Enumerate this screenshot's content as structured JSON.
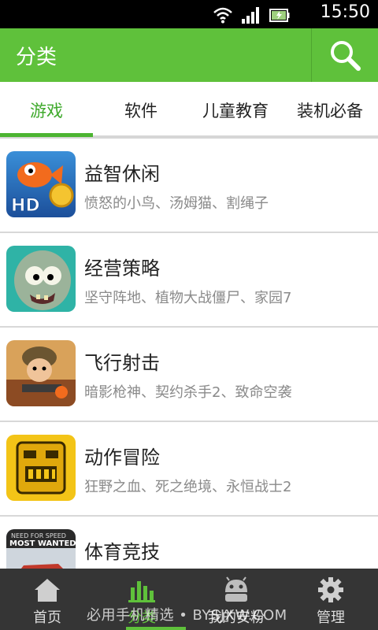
{
  "status_bar": {
    "time": "15:50",
    "icons": [
      "wifi-icon",
      "signal-icon",
      "battery-icon"
    ]
  },
  "app_bar": {
    "title": "分类",
    "search_icon": "search-icon"
  },
  "tabs": [
    {
      "label": "游戏",
      "active": true
    },
    {
      "label": "软件",
      "active": false
    },
    {
      "label": "儿童教育",
      "active": false
    },
    {
      "label": "装机必备",
      "active": false
    }
  ],
  "categories": [
    {
      "name": "益智休闲",
      "desc": "愤怒的小鸟、汤姆猫、割绳子",
      "icon": "fish-hd-icon"
    },
    {
      "name": "经营策略",
      "desc": "坚守阵地、植物大战僵尸、家园7",
      "icon": "zombie-icon"
    },
    {
      "name": "飞行射击",
      "desc": "暗影枪神、契约杀手2、致命空袭",
      "icon": "soldier-icon"
    },
    {
      "name": "动作冒险",
      "desc": "狂野之血、死之绝境、永恒战士2",
      "icon": "temple-idol-icon"
    },
    {
      "name": "体育竞技",
      "desc": "",
      "icon": "race-car-icon"
    }
  ],
  "bottom_nav": [
    {
      "label": "首页",
      "icon": "home-icon",
      "active": false
    },
    {
      "label": "分类",
      "icon": "bar-chart-icon",
      "active": true
    },
    {
      "label": "我的安粉",
      "icon": "android-icon",
      "active": false
    },
    {
      "label": "管理",
      "icon": "gear-icon",
      "active": false
    }
  ],
  "watermark": "必用手机精选 • BYSJXW.COM",
  "colors": {
    "accent": "#5fc13b",
    "bottom_bar": "#353535"
  }
}
